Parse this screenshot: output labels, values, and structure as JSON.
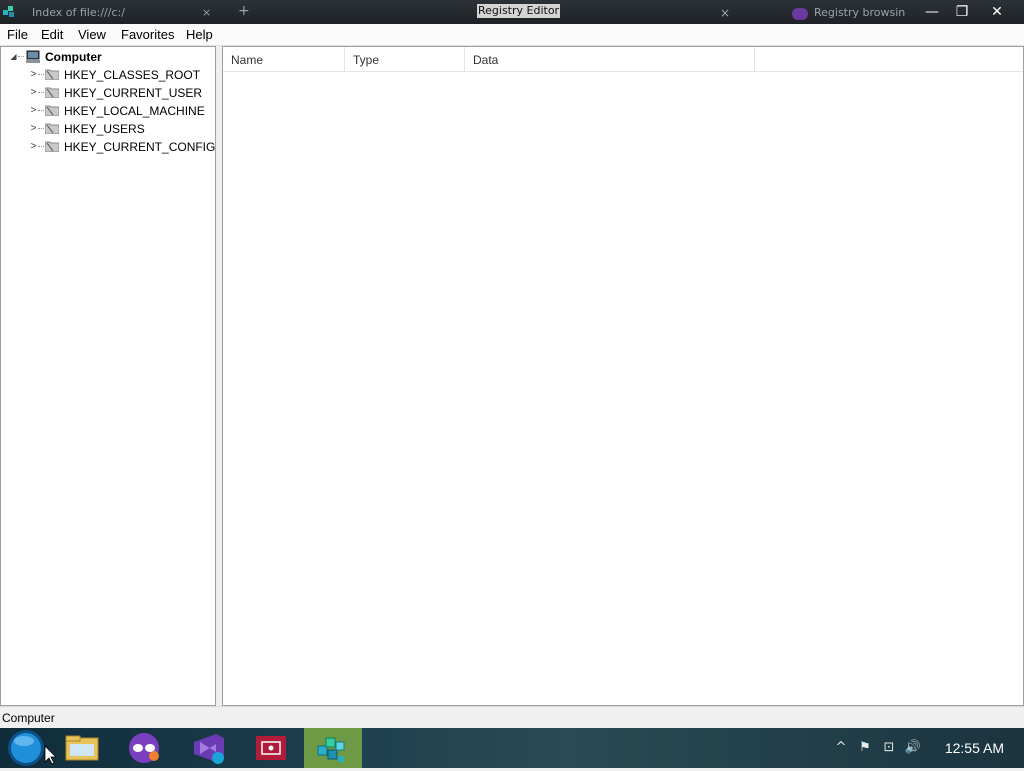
{
  "window": {
    "title": "Registry Editor",
    "background_tabs": {
      "tab1": "Index of file:///c:/",
      "new_tab": "+",
      "tab1_close": "×",
      "tab2": "Registry browsing"
    },
    "controls": {
      "minimize": "—",
      "maximize": "❐",
      "close": "✕"
    }
  },
  "menubar": {
    "items": [
      "File",
      "Edit",
      "View",
      "Favorites",
      "Help"
    ]
  },
  "tree": {
    "root": {
      "label": "Computer",
      "expander": "◢"
    },
    "children": [
      {
        "label": "HKEY_CLASSES_ROOT",
        "expander": ">"
      },
      {
        "label": "HKEY_CURRENT_USER",
        "expander": ">"
      },
      {
        "label": "HKEY_LOCAL_MACHINE",
        "expander": ">"
      },
      {
        "label": "HKEY_USERS",
        "expander": ">"
      },
      {
        "label": "HKEY_CURRENT_CONFIG",
        "expander": ">"
      }
    ]
  },
  "list": {
    "columns": [
      "Name",
      "Type",
      "Data"
    ]
  },
  "statusbar": {
    "path": "Computer"
  },
  "taskbar": {
    "clock": "12:55 AM",
    "tray": {
      "chevron": "^",
      "flag": "⚑",
      "network": "⊡",
      "volume": "🔊"
    },
    "colors": {
      "active_highlight": "#6f9a45",
      "ie_blue": "#1e8fd8",
      "vs_purple": "#7a3fbf",
      "red_app": "#b01c3a"
    }
  }
}
